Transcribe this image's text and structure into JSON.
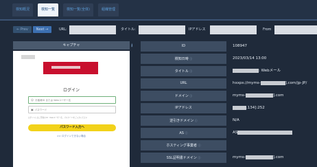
{
  "tabs": [
    {
      "label": "検知概況",
      "active": false
    },
    {
      "label": "検知一覧",
      "active": true
    },
    {
      "label": "検知一覧(全体)",
      "active": false
    },
    {
      "label": "組織管理",
      "active": false
    }
  ],
  "nav": {
    "prev_label": "← Prev",
    "next_label": "Next →",
    "url_label": "URL:",
    "title_label": "タイトル:",
    "ip_label": "IPアドレス",
    "from_label": "From"
  },
  "screenshot": {
    "header": "キャプチャ",
    "login_title": "ログイン",
    "user_placeholder": "お客様ID または Webユーザー名",
    "pass_placeholder": "パスワード",
    "note": "ログインにはご登録のID・Webユーザー名、パスワードをご入力ください",
    "submit_label": "パスワード入力へ",
    "forgot_label": ">> ログインできない場合"
  },
  "details": [
    {
      "label": "ID",
      "value": "108947",
      "help": false
    },
    {
      "label": "検知日時",
      "value": "2023/03/14 13:00",
      "help": true
    },
    {
      "label": "タイトル",
      "value": ": Webメール",
      "help": true,
      "masked_prefix": true
    },
    {
      "label": "URL",
      "value": "hxxps://myms-",
      "value_tail": "].com/jp-JP/",
      "help": false,
      "masked_mid": true
    },
    {
      "label": "ドメイン",
      "value": "myms-",
      "value_tail": "].com",
      "help": true,
      "masked_mid": true
    },
    {
      "label": "IPアドレス",
      "value": "",
      "value_tail": ".134]:252",
      "help": false,
      "masked_prefix_only": true
    },
    {
      "label": "逆引きドメイン",
      "value": "N/A",
      "help": true
    },
    {
      "label": "AS",
      "value": "AS",
      "help": true,
      "masked_mid": true,
      "value_tail": ""
    },
    {
      "label": "ホスティング事業者",
      "value": "",
      "help": true
    },
    {
      "label": "SSL証明書ドメイン",
      "value": "myms-",
      "value_tail": "].com",
      "help": true,
      "masked_mid": true
    }
  ]
}
